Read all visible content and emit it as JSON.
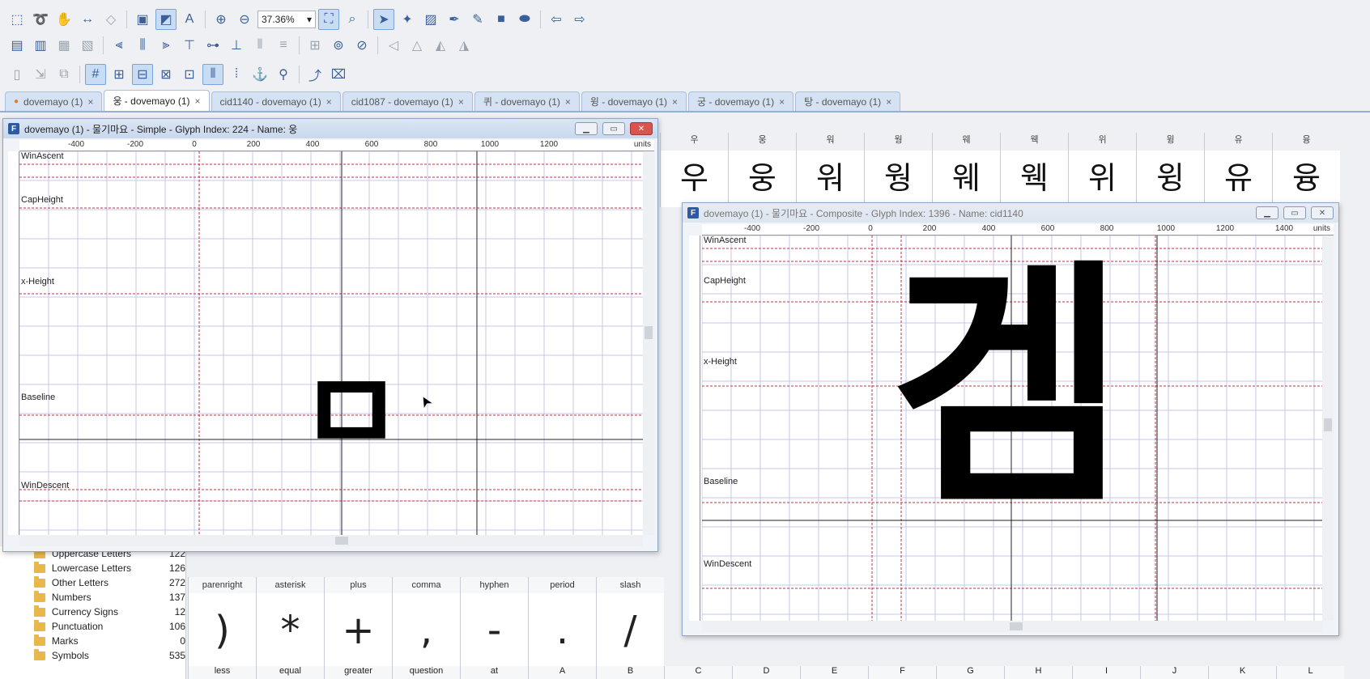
{
  "toolbar": {
    "zoom": "37.36%"
  },
  "tabs": [
    {
      "label": "dovemayo (1)",
      "active": false,
      "modified": true
    },
    {
      "label": "웅 - dovemayo (1)",
      "active": true
    },
    {
      "label": "cid1140 - dovemayo (1)",
      "active": false
    },
    {
      "label": "cid1087 - dovemayo (1)",
      "active": false
    },
    {
      "label": "퀴 - dovemayo (1)",
      "active": false
    },
    {
      "label": "윙 - dovemayo (1)",
      "active": false
    },
    {
      "label": "궁 - dovemayo (1)",
      "active": false
    },
    {
      "label": "탕 - dovemayo (1)",
      "active": false
    }
  ],
  "background_grid": {
    "headers": [
      "우",
      "웅",
      "워",
      "웡",
      "웨",
      "웩",
      "위",
      "윙",
      "유",
      "융"
    ],
    "glyphs": [
      "우",
      "웅",
      "워",
      "웡",
      "웨",
      "웩",
      "위",
      "윙",
      "유",
      "융"
    ]
  },
  "glyph_window_1": {
    "title": "dovemayo (1) - 물기마요 - Simple - Glyph Index: 224 - Name: 웅",
    "ruler_ticks": [
      "-400",
      "-200",
      "0",
      "200",
      "400",
      "600",
      "800",
      "1000",
      "1200"
    ],
    "units": "units",
    "metrics": [
      "WinAscent",
      "CapHeight",
      "x-Height",
      "Baseline",
      "WinDescent"
    ],
    "glyph": "ㅁ"
  },
  "glyph_window_2": {
    "title": "dovemayo (1) - 물기마요 - Composite - Glyph Index: 1396 - Name: cid1140",
    "ruler_ticks": [
      "-400",
      "-200",
      "0",
      "200",
      "400",
      "600",
      "800",
      "1000",
      "1200",
      "1400"
    ],
    "units": "units",
    "metrics": [
      "WinAscent",
      "CapHeight",
      "x-Height",
      "Baseline",
      "WinDescent"
    ],
    "glyph": "겜"
  },
  "sidebar": {
    "items": [
      {
        "label": "Uppercase Letters",
        "count": "122"
      },
      {
        "label": "Lowercase Letters",
        "count": "126"
      },
      {
        "label": "Other Letters",
        "count": "272"
      },
      {
        "label": "Numbers",
        "count": "137"
      },
      {
        "label": "Currency Signs",
        "count": "12"
      },
      {
        "label": "Punctuation",
        "count": "106"
      },
      {
        "label": "Marks",
        "count": "0"
      },
      {
        "label": "Symbols",
        "count": "535"
      }
    ]
  },
  "bottom_grid": {
    "names": [
      "parenright",
      "asterisk",
      "plus",
      "comma",
      "hyphen",
      "period",
      "slash"
    ],
    "chars": [
      ")",
      "*",
      "+",
      ",",
      "-",
      ".",
      "/"
    ],
    "names_row2": [
      "less",
      "equal",
      "greater",
      "question",
      "at",
      "A",
      "B",
      "C",
      "D",
      "E",
      "F",
      "G",
      "H",
      "I",
      "J",
      "K",
      "L"
    ]
  }
}
